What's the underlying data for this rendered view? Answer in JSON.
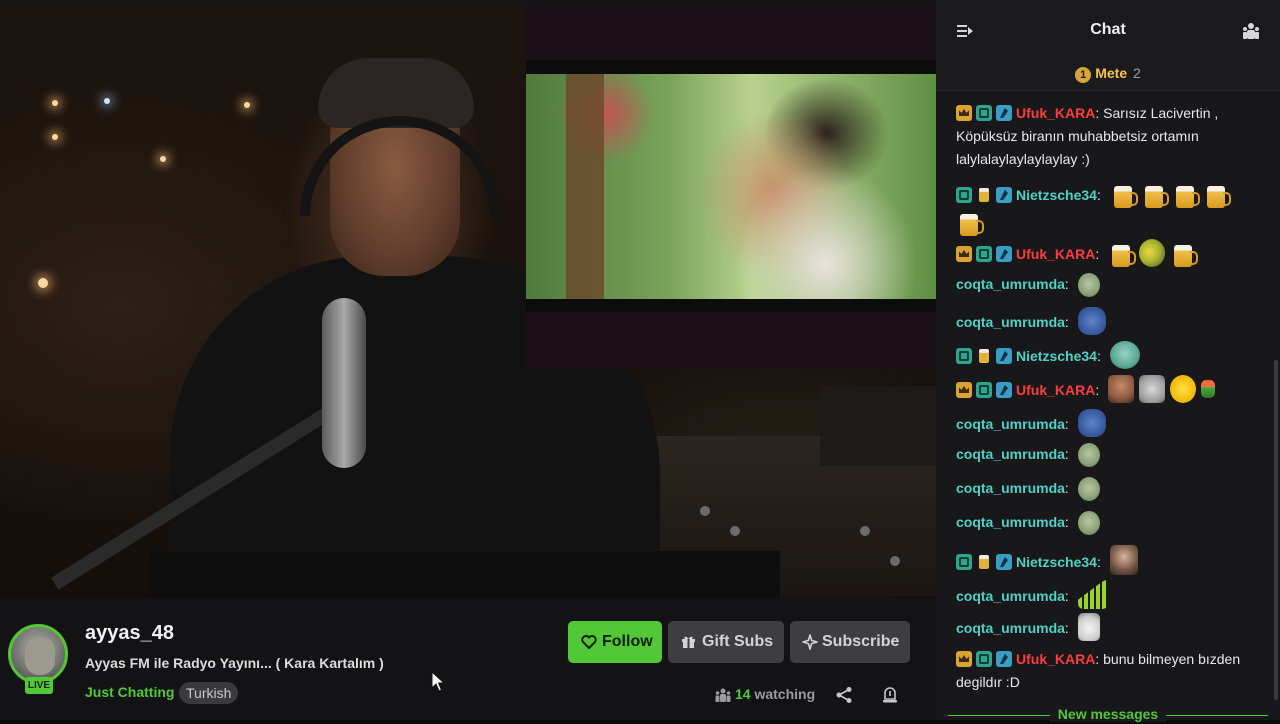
{
  "chat": {
    "title": "Chat",
    "pinned": {
      "rank": "1",
      "name": "Mete",
      "count": "2"
    },
    "messages": [
      {
        "user": "Ufuk_KARA",
        "text": "Sarısız Lacivertin , Köpüksüz biranın muhabbetsiz ortamın lalylalaylaylaylaylay :)"
      },
      {
        "user": "Nietzsche34",
        "text": ""
      },
      {
        "user": "Ufuk_KARA",
        "text": ""
      },
      {
        "user": "coqta_umrumda",
        "text": ""
      },
      {
        "user": "coqta_umrumda",
        "text": ""
      },
      {
        "user": "Nietzsche34",
        "text": ""
      },
      {
        "user": "Ufuk_KARA",
        "text": ""
      },
      {
        "user": "coqta_umrumda",
        "text": ""
      },
      {
        "user": "coqta_umrumda",
        "text": ""
      },
      {
        "user": "coqta_umrumda",
        "text": ""
      },
      {
        "user": "coqta_umrumda",
        "text": ""
      },
      {
        "user": "Nietzsche34",
        "text": ""
      },
      {
        "user": "coqta_umrumda",
        "text": ""
      },
      {
        "user": "coqta_umrumda",
        "text": ""
      },
      {
        "user": "Ufuk_KARA",
        "text": "bunu bilmeyen bızden degildır :D"
      }
    ],
    "new_messages_label": "New messages"
  },
  "stream": {
    "channel": "ayyas_48",
    "title": "Ayyas FM ile Radyo Yayını... ( Kara Kartalım )",
    "category": "Just Chatting",
    "tag": "Turkish",
    "live_label": "LIVE",
    "viewers_count": "14",
    "viewers_label": "watching"
  },
  "actions": {
    "follow": "Follow",
    "gift": "Gift Subs",
    "subscribe": "Subscribe"
  },
  "colors": {
    "accent": "#53c836",
    "username_red": "#ff3d3d",
    "username_teal": "#4fd1c5",
    "pinned_gold": "#f5c542"
  }
}
